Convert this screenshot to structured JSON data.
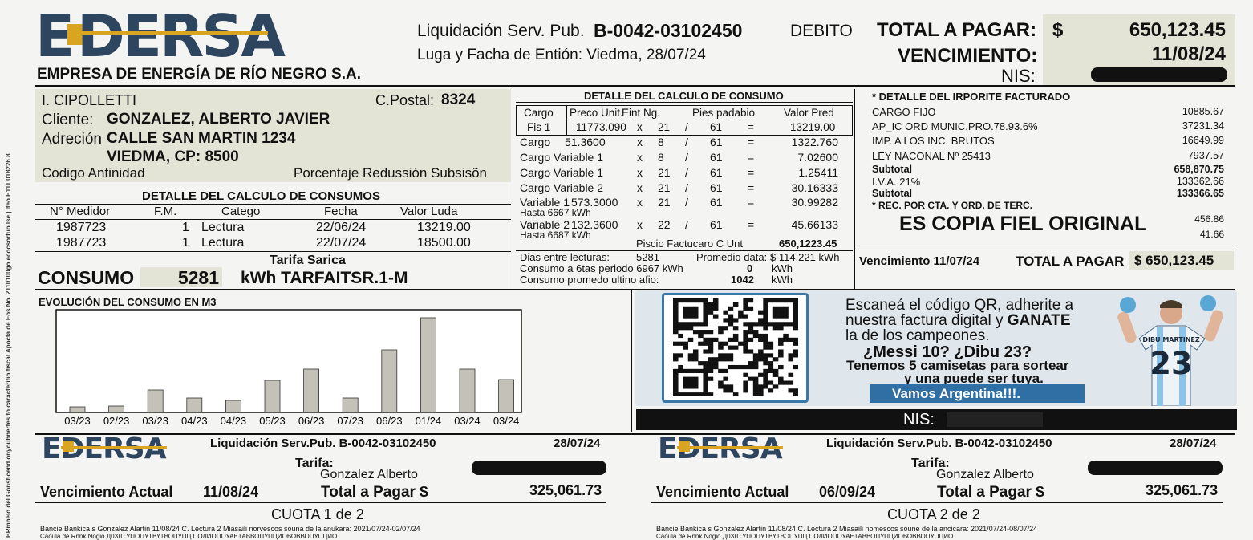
{
  "brand": {
    "logo_text": "EDERSA",
    "company_name": "EMPRESA DE ENERGÍA DE RÍO NEGRO S.A."
  },
  "header": {
    "liquidacion_label": "Liquidación Serv. Pub.",
    "liquidacion_number": "B-0042-03102450",
    "debito": "DEBITO",
    "lugar_fecha": "Luga y Facha de Entión: Viedma, 28/07/24",
    "total_label": "TOTAL A PAGAR:",
    "total_currency": "$",
    "total_value": "650,123.45",
    "vencimiento_label": "VENCIMIENTO:",
    "vencimiento_value": "11/08/24",
    "nis_label": "NIS:"
  },
  "side_text": "BRmnelo del Gonstlcend onyouhnertes to caracterítio fiscal Apocta de Eos No. 2110100go ecocsortuo Ise | Iteo E111 018226 8",
  "client": {
    "location": "I. CIPOLLETTI",
    "cp_label": "C.Postal:",
    "cp_value": "8324",
    "cliente_label": "Cliente:",
    "cliente_value": "GONZALEZ, ALBERTO JAVIER",
    "adrecion_label": "Adreción",
    "adrecion_line1": "CALLE SAN MARTIN 1234",
    "adrecion_line2": "VIEDMA, CP: 8500",
    "codigo": "Codigo Antinidad",
    "porcentaje": "Porcentaje Redussión Subsisõn"
  },
  "consumos": {
    "title": "DETALLE DEL CALCULO DE CONSUMOS",
    "headers": [
      "N° Medidor",
      "F.M.",
      "Catego",
      "Fecha",
      "Valor Luda"
    ],
    "rows": [
      [
        "1987723",
        "1",
        "Lectura",
        "22/06/24",
        "13219.00"
      ],
      [
        "1987723",
        "1",
        "Lectura",
        "22/07/24",
        "18500.00"
      ]
    ],
    "tarifa": "Tarifa Sarica",
    "consumo_label": "CONSUMO",
    "consumo_value": "5281",
    "consumo_unit": "kWh TARFAITSR.1-M"
  },
  "calculo": {
    "title": "DETALLE DEL CALCULO DE CONSUMO",
    "headers": [
      "Cargo",
      "Preco Unit.",
      "Eint Ng.",
      "Pies padabio",
      "Valor Pred"
    ],
    "first_row": [
      "Fis 1",
      "11773.090",
      "x",
      "21",
      "/",
      "61",
      "=",
      "13219.00"
    ],
    "rows": [
      {
        "c": "Cargo",
        "u": "51.3600",
        "x": "x",
        "n": "8",
        "s": "/",
        "p": "61",
        "e": "=",
        "v": "1322.760",
        "sub": ""
      },
      {
        "c": "Cargo Variable 1",
        "u": "",
        "x": "x",
        "n": "8",
        "s": "/",
        "p": "61",
        "e": "=",
        "v": "7.02600",
        "sub": ""
      },
      {
        "c": "Cargo Variable 1",
        "u": "",
        "x": "x",
        "n": "21",
        "s": "/",
        "p": "61",
        "e": "=",
        "v": "1.25411",
        "sub": ""
      },
      {
        "c": "Cargo Variable 2",
        "u": "",
        "x": "x",
        "n": "21",
        "s": "/",
        "p": "61",
        "e": "=",
        "v": "30.16333",
        "sub": ""
      },
      {
        "c": "Variable 1",
        "u": "573.3000",
        "x": "x",
        "n": "21",
        "s": "/",
        "p": "61",
        "e": "=",
        "v": "30.99282",
        "sub": "Hasta 6667 kWh"
      },
      {
        "c": "Variable 2",
        "u": "132.3600",
        "x": "x",
        "n": "22",
        "s": "/",
        "p": "61",
        "e": "=",
        "v": "45.66133",
        "sub": "Hasta 6687 kWh"
      }
    ],
    "precio_label": "Piscio Factucaro C Unt",
    "precio_value": "650,1223.45",
    "dias_label": "Dias entre lecturas:",
    "dias_value": "5281",
    "promedio_label": "Promedio data:",
    "promedio_value": "$ 114.221 kWh",
    "consumo6_label": "Consumo a 6tas periodo 6967 kWh",
    "consumo6_value": "0",
    "consumo6_unit": "kWh",
    "prom_ultimo_label": "Consumo promedo ultino afio:",
    "prom_ultimo_value": "1042",
    "prom_ultimo_unit": "kWh"
  },
  "importe": {
    "title": "* DETALLE DEL IRPORITE FACTURADO",
    "rows": [
      {
        "l": "CARGO FIJO",
        "v": "10885.67",
        "b": false
      },
      {
        "l": "AP_IC ORD MUNIC.PRO.78.93.6%",
        "v": "37231.34",
        "b": false
      },
      {
        "l": "IMP. A LOS INC. BRUTOS",
        "v": "16649.99",
        "b": false
      },
      {
        "l": "LEY NACONAL Nº 25413",
        "v": "7937.57",
        "b": false
      },
      {
        "l": "Subtotal",
        "v": "658,870.75",
        "b": true
      },
      {
        "l": "I.V.A. 21%",
        "v": "133362.66",
        "b": false
      },
      {
        "l": "Subtotal",
        "v": "133366.65",
        "b": true
      }
    ],
    "rec_label": "* REC. POR CTA. Y ORD. DE TERC.",
    "copia": "ES COPIA FIEL ORIGINAL",
    "extra1": "456.86",
    "extra2": "41.66",
    "venc_label": "Vencimiento 11/07/24",
    "total_label": "TOTAL A PAGAR",
    "total_value": "$ 650,123.45"
  },
  "chart_data": {
    "type": "bar",
    "title": "EVOLUCIÓN DEL CONSUMO EN M3",
    "categories": [
      "03/23",
      "02/23",
      "03/23",
      "04/23",
      "04/23",
      "05/23",
      "06/23",
      "07/23",
      "06/23",
      "01/24",
      "03/24",
      "03/24"
    ],
    "values": [
      7,
      8,
      28,
      18,
      15,
      40,
      54,
      18,
      78,
      118,
      54,
      41
    ],
    "ylim": [
      0,
      128
    ],
    "grid": false
  },
  "promo": {
    "line1": "Escaneá el código QR, adherite a",
    "line2a": "nuestra factura digital y ",
    "line2b": "GANATE",
    "line3": "la de los campeones.",
    "line4": "¿Messi 10? ¿Dibu 23?",
    "line5": "Tenemos 5 camisetas para sortear",
    "line6": "y una puede ser tuya.",
    "banner": "Vamos Argentina!!!.",
    "jersey_name": "DIBU MARTINEZ",
    "jersey_number": "23",
    "nis_label": "NIS:"
  },
  "coupons": [
    {
      "logo": "EDERSA",
      "liquidacion": "Liquidación Serv.Pub. B-0042-03102450",
      "date": "28/07/24",
      "tarifa": "Tarifa:",
      "name": "Gonzalez Alberto",
      "venc_label": "Vencimiento Actual",
      "venc_value": "11/08/24",
      "total_label": "Total a Pagar $",
      "total_value": "325,061.73",
      "cuota": "CUOTA 1 de 2",
      "footer1": "Bancie Bankica s Gonzalez Alartin 11/08/24 C. Lectura 2 Miasaili norvescos souna de la anukara: 2021/07/24-02/07/24",
      "footer2": "Caoula de Rnnk Nogio  Д03ЛТУПОПУТВҮТВОПУПЦ ПОЛИОПОУАЕТАВВОПУПЦИОВОВВОПУПЦИО"
    },
    {
      "logo": "EDERSA",
      "liquidacion": "Liquidación Serv.Pub. B-0042-03102450",
      "date": "28/07/24",
      "tarifa": "Tarifa:",
      "name": "Gonzalez Alberto",
      "venc_label": "Vencimiento Actual",
      "venc_value": "06/09/24",
      "total_label": "Total a Pagar $",
      "total_value": "325,061.73",
      "cuota": "CUOTA 2 de 2",
      "footer1": "Bancie Bankica s Gonzalez Alartin 11/08/24 C. Lèctura 2 Miasaili nomescos soune de la ancicara: 2021/07/24-08/07/24",
      "footer2": "Caoula de Rnnk Nogio  Д03ЛТУПОПУТВҮТВОПУПЦ ПОЛИОПОУАЕТАВВОПУПЦИОВОВВОПУПЦИО"
    }
  ]
}
